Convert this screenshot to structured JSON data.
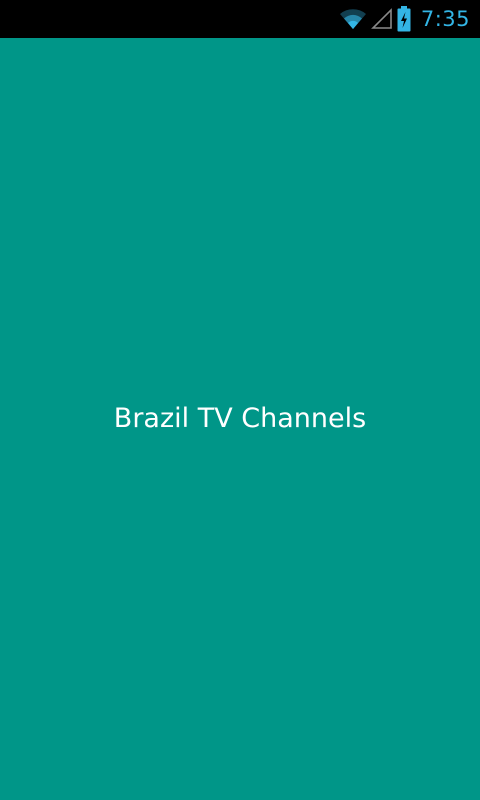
{
  "status_bar": {
    "time": "7:35",
    "icons": [
      "wifi-icon",
      "cell-signal-icon",
      "battery-charging-icon"
    ],
    "icon_color": "#33b5e5"
  },
  "splash": {
    "title": "Brazil TV Channels",
    "background_color": "#009688",
    "text_color": "#ffffff"
  }
}
